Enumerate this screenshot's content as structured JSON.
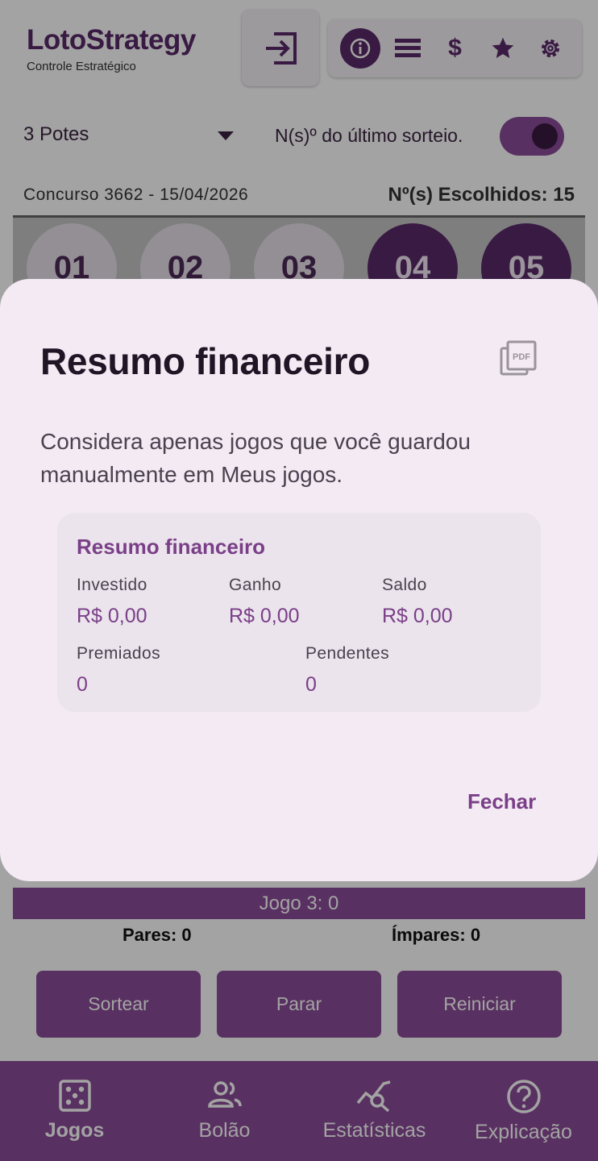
{
  "header": {
    "brand_title": "LotoStrategy",
    "brand_subtitle": "Controle Estratégico",
    "toolbar_icons": [
      "info-icon",
      "list-icon",
      "dollar-icon",
      "star-icon",
      "gear-icon"
    ],
    "dollar_glyph": "$"
  },
  "controls": {
    "potes_value": "3 Potes",
    "last_draw_label": "N(s)º do último sorteio.",
    "last_draw_toggle_on": true
  },
  "contest": {
    "label": "Concurso 3662 - 15/04/2026",
    "chosen": "Nº(s) Escolhidos: 15"
  },
  "balls": [
    {
      "num": "01",
      "selected": false
    },
    {
      "num": "02",
      "selected": false
    },
    {
      "num": "03",
      "selected": false
    },
    {
      "num": "04",
      "selected": true
    },
    {
      "num": "05",
      "selected": true
    }
  ],
  "game": {
    "jogo_bar": "Jogo 3: 0",
    "pares": "Pares: 0",
    "impares": "Ímpares: 0"
  },
  "actions": {
    "sortear": "Sortear",
    "parar": "Parar",
    "reiniciar": "Reiniciar"
  },
  "nav": {
    "jogos": "Jogos",
    "bolao": "Bolão",
    "estatisticas": "Estatísticas",
    "explicacao": "Explicação"
  },
  "dialog": {
    "title": "Resumo financeiro",
    "pdf_label": "PDF",
    "description": "Considera apenas jogos que você guardou manualmente em Meus jogos.",
    "card": {
      "title": "Resumo financeiro",
      "investido_label": "Investido",
      "investido_value": "R$ 0,00",
      "ganho_label": "Ganho",
      "ganho_value": "R$ 0,00",
      "saldo_label": "Saldo",
      "saldo_value": "R$ 0,00",
      "premiados_label": "Premiados",
      "premiados_value": "0",
      "pendentes_label": "Pendentes",
      "pendentes_value": "0"
    },
    "close_label": "Fechar"
  },
  "colors": {
    "primary": "#8a4c98",
    "primary_dark": "#5a2a6a",
    "dialog_bg": "#f3eaf3",
    "card_bg": "#ebe4ec"
  }
}
